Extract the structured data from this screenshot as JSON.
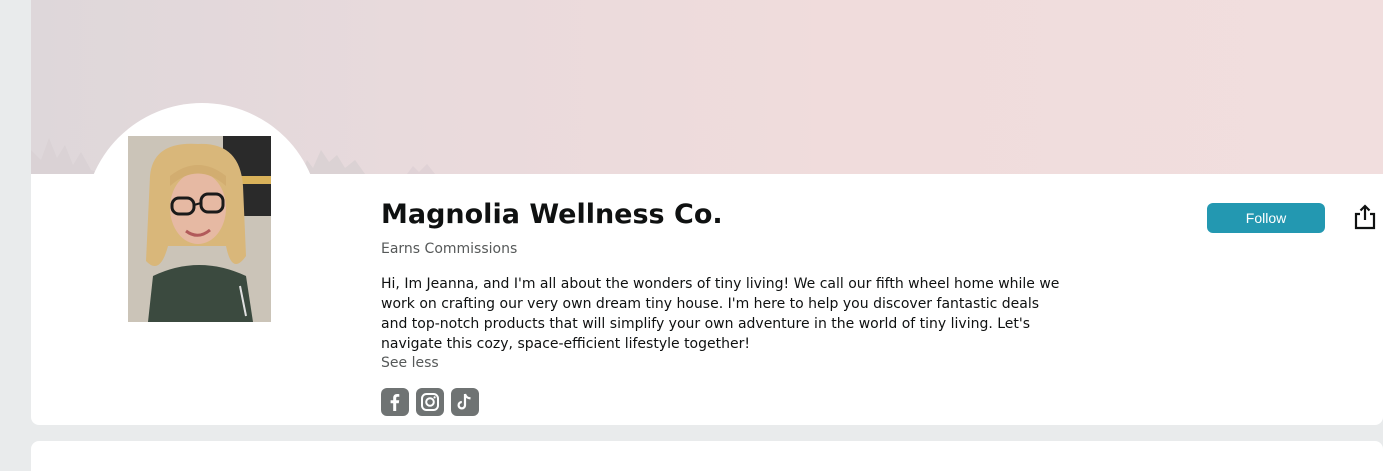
{
  "profile": {
    "name": "Magnolia Wellness Co.",
    "subtitle": "Earns Commissions",
    "bio": "Hi, Im Jeanna, and I'm all about the wonders of tiny living! We call our fifth wheel home while we work on crafting our very own dream tiny house. I'm here to help you discover fantastic deals and top-notch products that will simplify your own adventure in the world of tiny living. Let's navigate this cozy, space-efficient lifestyle together!",
    "see_less": "See less"
  },
  "actions": {
    "follow_label": "Follow",
    "share_icon": "share-icon"
  },
  "socials": [
    {
      "icon": "facebook-icon"
    },
    {
      "icon": "instagram-icon"
    },
    {
      "icon": "tiktok-icon"
    }
  ],
  "colors": {
    "accent": "#2398b1",
    "social_icon_bg": "#6f7373",
    "banner": "#f0dcdc"
  }
}
